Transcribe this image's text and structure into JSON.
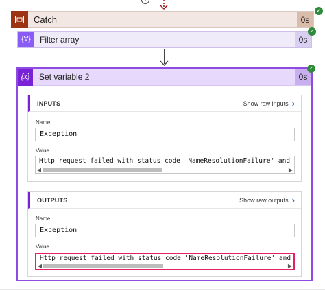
{
  "top": {
    "info_glyph": "i"
  },
  "catch": {
    "label": "Catch",
    "duration": "0s",
    "status_icon": "check-icon"
  },
  "filter_array": {
    "label": "Filter array",
    "duration": "0s",
    "icon_text": "{∀}"
  },
  "set_variable": {
    "label": "Set variable 2",
    "duration": "0s",
    "icon_text": "{x}",
    "inputs": {
      "title": "INPUTS",
      "raw_link": "Show raw inputs",
      "name_label": "Name",
      "name_value": "Exception",
      "value_label": "Value",
      "value_text": "Http request failed with status code 'NameResolutionFailure' and st"
    },
    "outputs": {
      "title": "OUTPUTS",
      "raw_link": "Show raw outputs",
      "name_label": "Name",
      "name_value": "Exception",
      "value_label": "Value",
      "value_text": "Http request failed with status code 'NameResolutionFailure' and st"
    }
  },
  "colors": {
    "catch_accent": "#9c3413",
    "filter_accent": "#8a5cf6",
    "setvar_accent": "#7a23d6",
    "success": "#2e8b3a",
    "highlight": "#e0245e",
    "link": "#1f6fc3"
  }
}
